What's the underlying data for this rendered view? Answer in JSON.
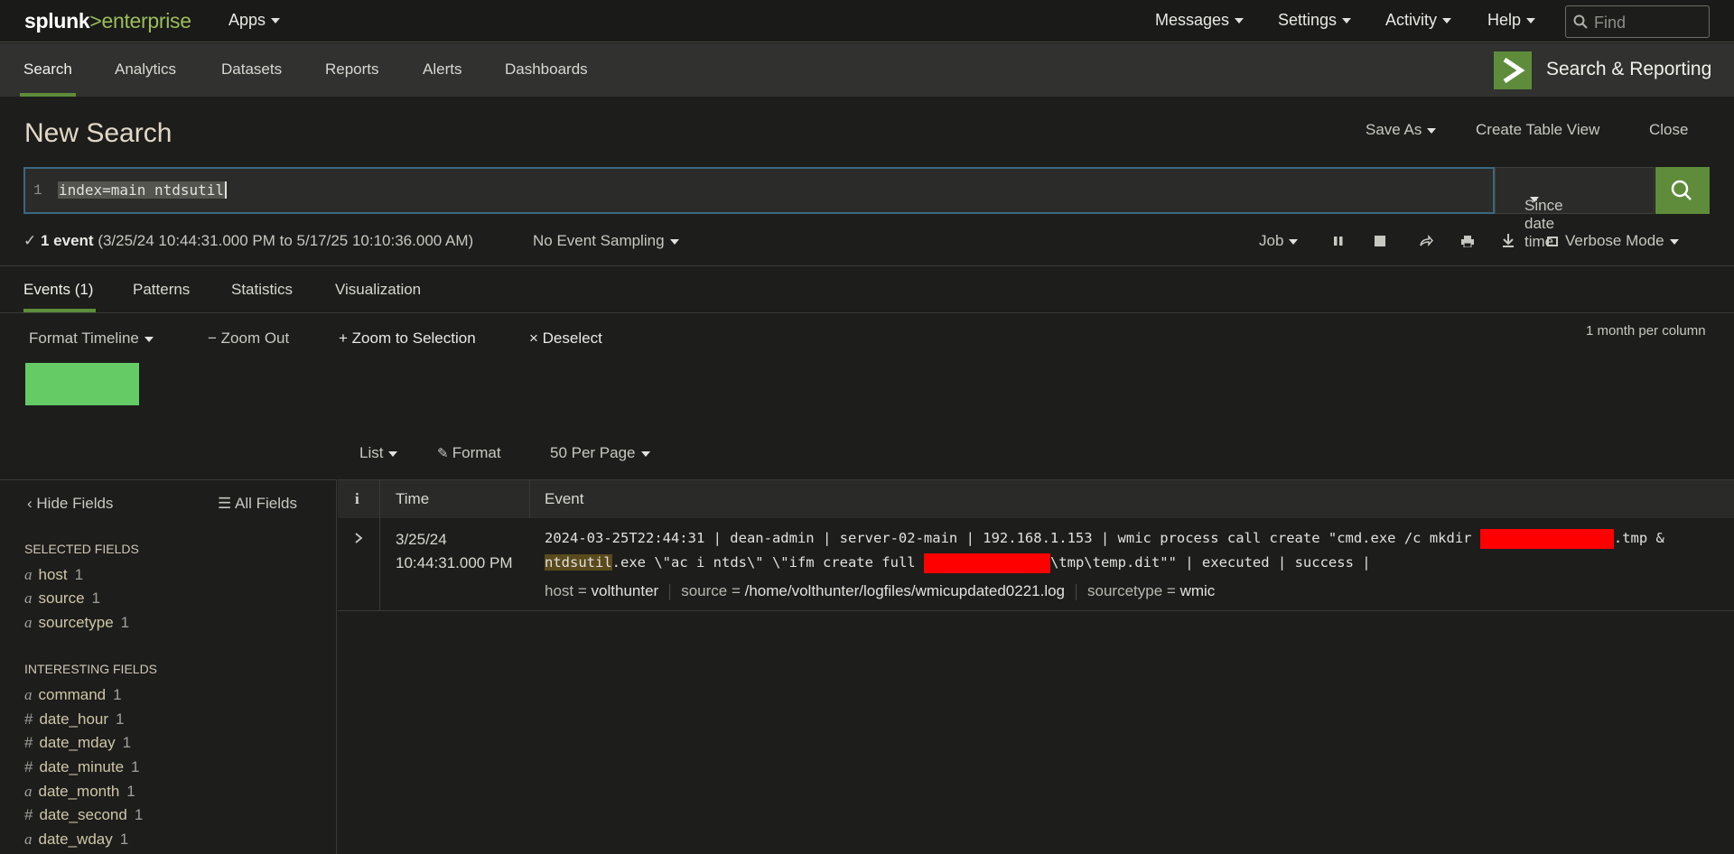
{
  "topbar": {
    "logo_splunk": "splunk",
    "logo_enterprise": ">enterprise",
    "apps": "Apps",
    "messages": "Messages",
    "settings": "Settings",
    "activity": "Activity",
    "help": "Help",
    "find_placeholder": "Find"
  },
  "appbar": {
    "nav": [
      "Search",
      "Analytics",
      "Datasets",
      "Reports",
      "Alerts",
      "Dashboards"
    ],
    "app_title": "Search & Reporting"
  },
  "page": {
    "title": "New Search",
    "save_as": "Save As",
    "create_table_view": "Create Table View",
    "close": "Close"
  },
  "search": {
    "line_number": "1",
    "query": "index=main ntdsutil",
    "time_range": "Since date time"
  },
  "status": {
    "check": "✓",
    "count": "1 event",
    "range": "(3/25/24 10:44:31.000 PM to 5/17/25 10:10:36.000 AM)",
    "sampling": "No Event Sampling",
    "job": "Job",
    "mode": "Verbose Mode"
  },
  "tabs": [
    "Events (1)",
    "Patterns",
    "Statistics",
    "Visualization"
  ],
  "timeline": {
    "format": "Format Timeline",
    "zoom_out": "Zoom Out",
    "zoom_selection": "Zoom to Selection",
    "deselect": "Deselect",
    "scale": "1 month per column",
    "bar_color": "#65cc65"
  },
  "listcontrols": {
    "list": "List",
    "format": "Format",
    "per_page": "50 Per Page"
  },
  "sidebar": {
    "hide_fields": "Hide Fields",
    "all_fields": "All Fields",
    "selected_heading": "SELECTED FIELDS",
    "selected": [
      {
        "type": "a",
        "name": "host",
        "count": "1"
      },
      {
        "type": "a",
        "name": "source",
        "count": "1"
      },
      {
        "type": "a",
        "name": "sourcetype",
        "count": "1"
      }
    ],
    "interesting_heading": "INTERESTING FIELDS",
    "interesting": [
      {
        "type": "a",
        "name": "command",
        "count": "1"
      },
      {
        "type": "#",
        "name": "date_hour",
        "count": "1"
      },
      {
        "type": "#",
        "name": "date_mday",
        "count": "1"
      },
      {
        "type": "#",
        "name": "date_minute",
        "count": "1"
      },
      {
        "type": "a",
        "name": "date_month",
        "count": "1"
      },
      {
        "type": "#",
        "name": "date_second",
        "count": "1"
      },
      {
        "type": "a",
        "name": "date_wday",
        "count": "1"
      }
    ]
  },
  "results": {
    "col_info": "i",
    "col_time": "Time",
    "col_event": "Event",
    "row": {
      "date": "3/25/24",
      "time": "10:44:31.000 PM",
      "event_part1": "2024-03-25T22:44:31 | dean-admin | server-02-main | 192.168.1.153 | wmic process call create \"cmd.exe /c mkdir ",
      "event_part2": ".tmp & ",
      "event_highlight1": "ntdsut",
      "event_highlight2": "il",
      "event_part3": ".exe \\\"ac i ntds\\\" \\\"ifm create full ",
      "event_part4": "\\tmp\\temp.dit\"\" | executed | success |",
      "host_label": "host =",
      "host_value": "volthunter",
      "source_label": "source =",
      "source_value": "/home/volthunter/logfiles/wmicupdated0221.log",
      "sourcetype_label": "sourcetype =",
      "sourcetype_value": "wmic"
    }
  }
}
